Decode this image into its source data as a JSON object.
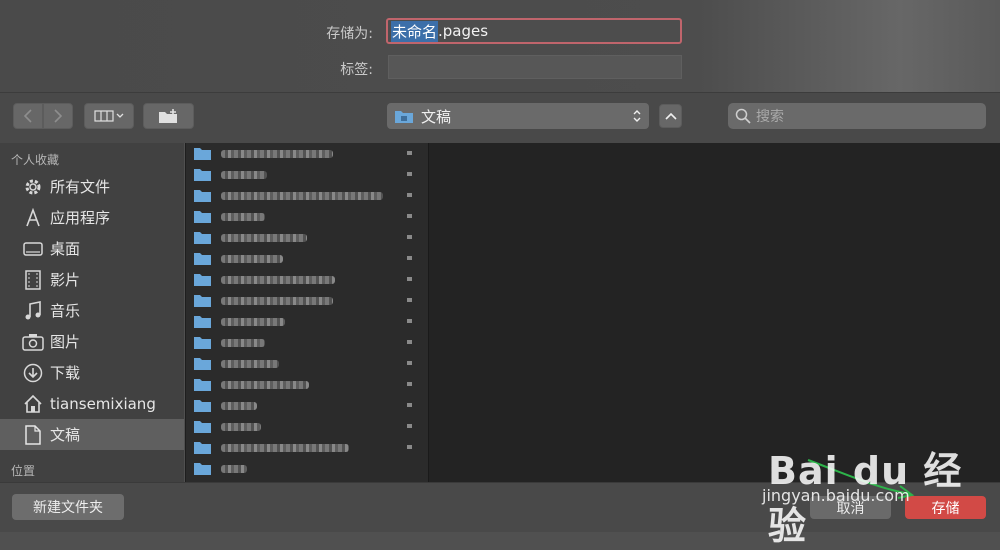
{
  "header": {
    "save_as_label": "存储为:",
    "filename_selected": "未命名",
    "filename_ext": ".pages",
    "tags_label": "标签:"
  },
  "toolbar": {
    "back_icon": "chevron-left-icon",
    "forward_icon": "chevron-right-icon",
    "view_icon": "columns-view-icon",
    "location": "文稿",
    "search_placeholder": "搜索"
  },
  "sidebar": {
    "favorites_header": "个人收藏",
    "items": [
      {
        "label": "所有文件",
        "icon": "gear-icon"
      },
      {
        "label": "应用程序",
        "icon": "applications-icon"
      },
      {
        "label": "桌面",
        "icon": "desktop-icon"
      },
      {
        "label": "影片",
        "icon": "film-icon"
      },
      {
        "label": "音乐",
        "icon": "music-icon"
      },
      {
        "label": "图片",
        "icon": "camera-icon"
      },
      {
        "label": "下载",
        "icon": "download-icon"
      },
      {
        "label": "tiansemixiang",
        "icon": "home-icon"
      },
      {
        "label": "文稿",
        "icon": "document-icon",
        "active": true
      }
    ],
    "locations_header": "位置"
  },
  "footer": {
    "new_folder": "新建文件夹",
    "cancel": "取消",
    "save": "存储"
  },
  "watermark": {
    "logo": "Bai  du 经验",
    "url": "jingyan.baidu.com"
  },
  "colors": {
    "accent_red": "#d24a46",
    "selection_blue": "#3c6fa9",
    "folder_blue": "#6aa7da"
  }
}
